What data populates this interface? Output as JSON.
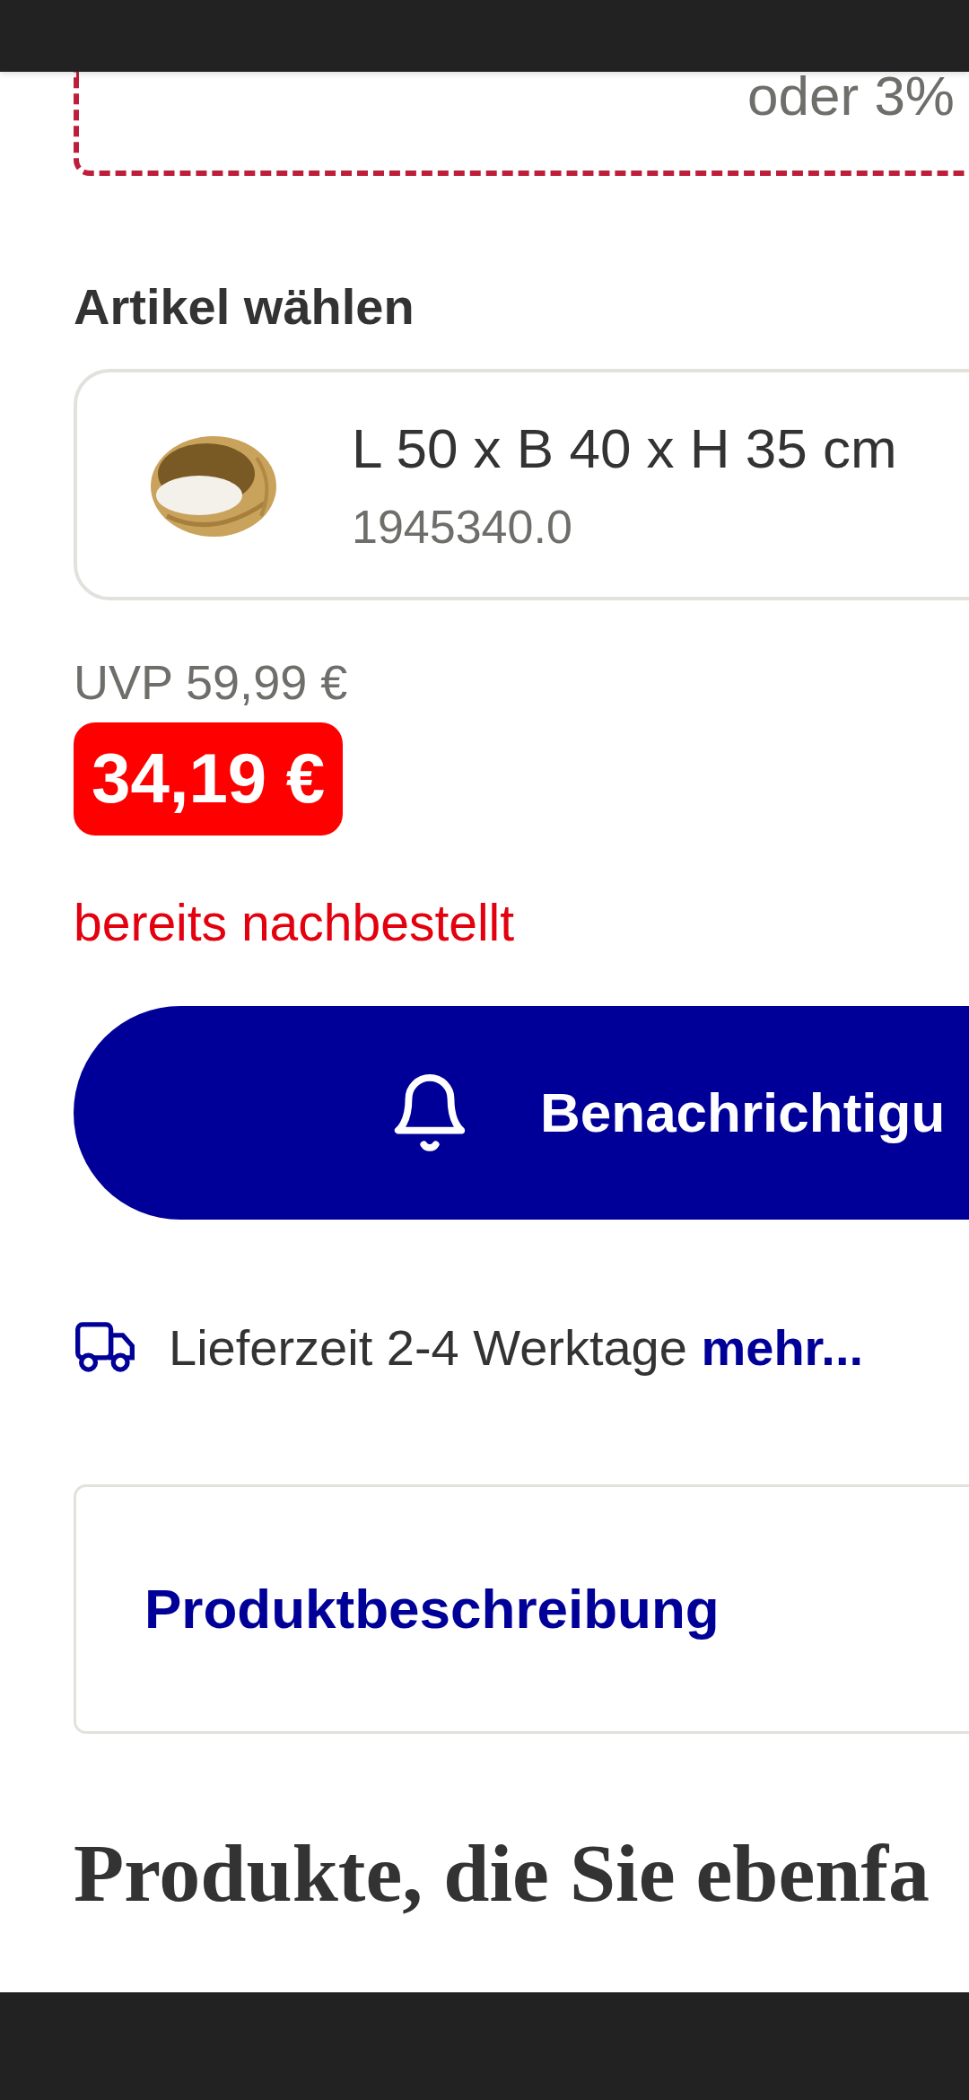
{
  "promo_box": {
    "text": "oder 3%"
  },
  "section_title": "Artikel wählen",
  "variants": [
    {
      "name": "L 50 x B 40 x H 35 cm",
      "article_number": "1945340.0"
    }
  ],
  "price": {
    "uvp": "UVP 59,99 €",
    "current": "34,19 €"
  },
  "stock_note": "bereits nachbestellt",
  "notify_button": {
    "label": "Benachrichtigu"
  },
  "delivery": {
    "text": "Lieferzeit 2-4 Werktage",
    "link": "mehr..."
  },
  "accordion": [
    {
      "title": "Produktbeschreibung"
    }
  ],
  "related_heading": "Produkte, die Sie ebenfa"
}
